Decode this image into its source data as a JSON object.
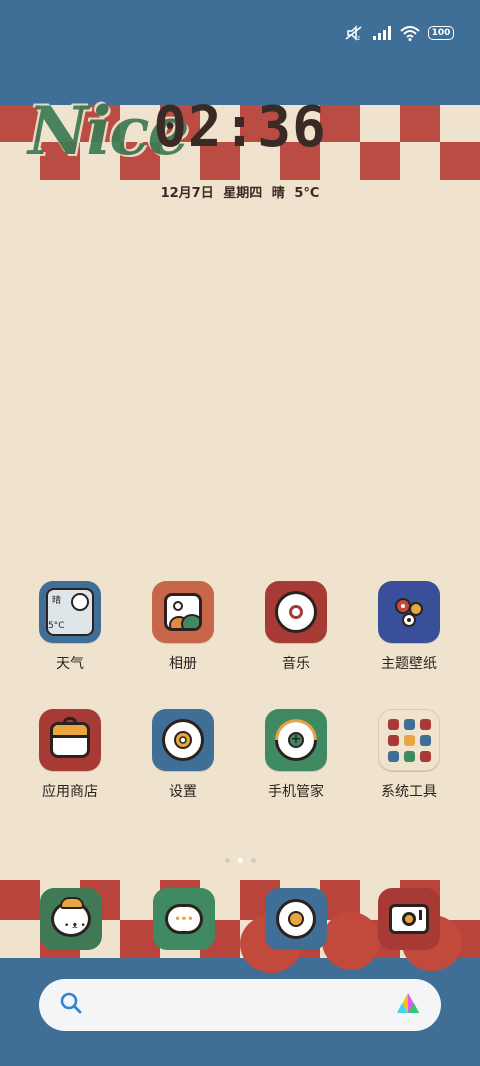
{
  "status_bar": {
    "icons": [
      "mute-icon",
      "signal-icon",
      "wifi-icon"
    ],
    "battery": "100"
  },
  "wallpaper": {
    "logo_text": "Nice"
  },
  "lockclock": {
    "time": "02:36",
    "date": "12月7日",
    "weekday": "星期四",
    "weather": "晴",
    "temperature": "5°C"
  },
  "apps": [
    {
      "label": "天气",
      "icon": "weather-icon",
      "color": "#3f6e96",
      "widget_text": "晴",
      "widget_temp": "5°C"
    },
    {
      "label": "相册",
      "icon": "gallery-icon",
      "color": "#c8664a"
    },
    {
      "label": "音乐",
      "icon": "music-icon",
      "color": "#a73a34"
    },
    {
      "label": "主题壁纸",
      "icon": "themes-icon",
      "color": "#3a4f99"
    },
    {
      "label": "应用商店",
      "icon": "app-store-icon",
      "color": "#a73a34"
    },
    {
      "label": "设置",
      "icon": "settings-icon",
      "color": "#3f6e96"
    },
    {
      "label": "手机管家",
      "icon": "security-icon",
      "color": "#3f8a63"
    },
    {
      "label": "系统工具",
      "icon": "folder-icon",
      "color": "#efe3cd"
    }
  ],
  "dock": [
    {
      "icon": "phone-icon",
      "color": "#3f7a55"
    },
    {
      "icon": "messages-icon",
      "color": "#3f8a63"
    },
    {
      "icon": "browser-icon",
      "color": "#3f6e96"
    },
    {
      "icon": "camera-icon",
      "color": "#a73a34"
    }
  ],
  "search": {
    "search_icon": "search-icon",
    "assistant_icon": "assistant-icon"
  },
  "pager": {
    "count": 3,
    "active": 2
  }
}
